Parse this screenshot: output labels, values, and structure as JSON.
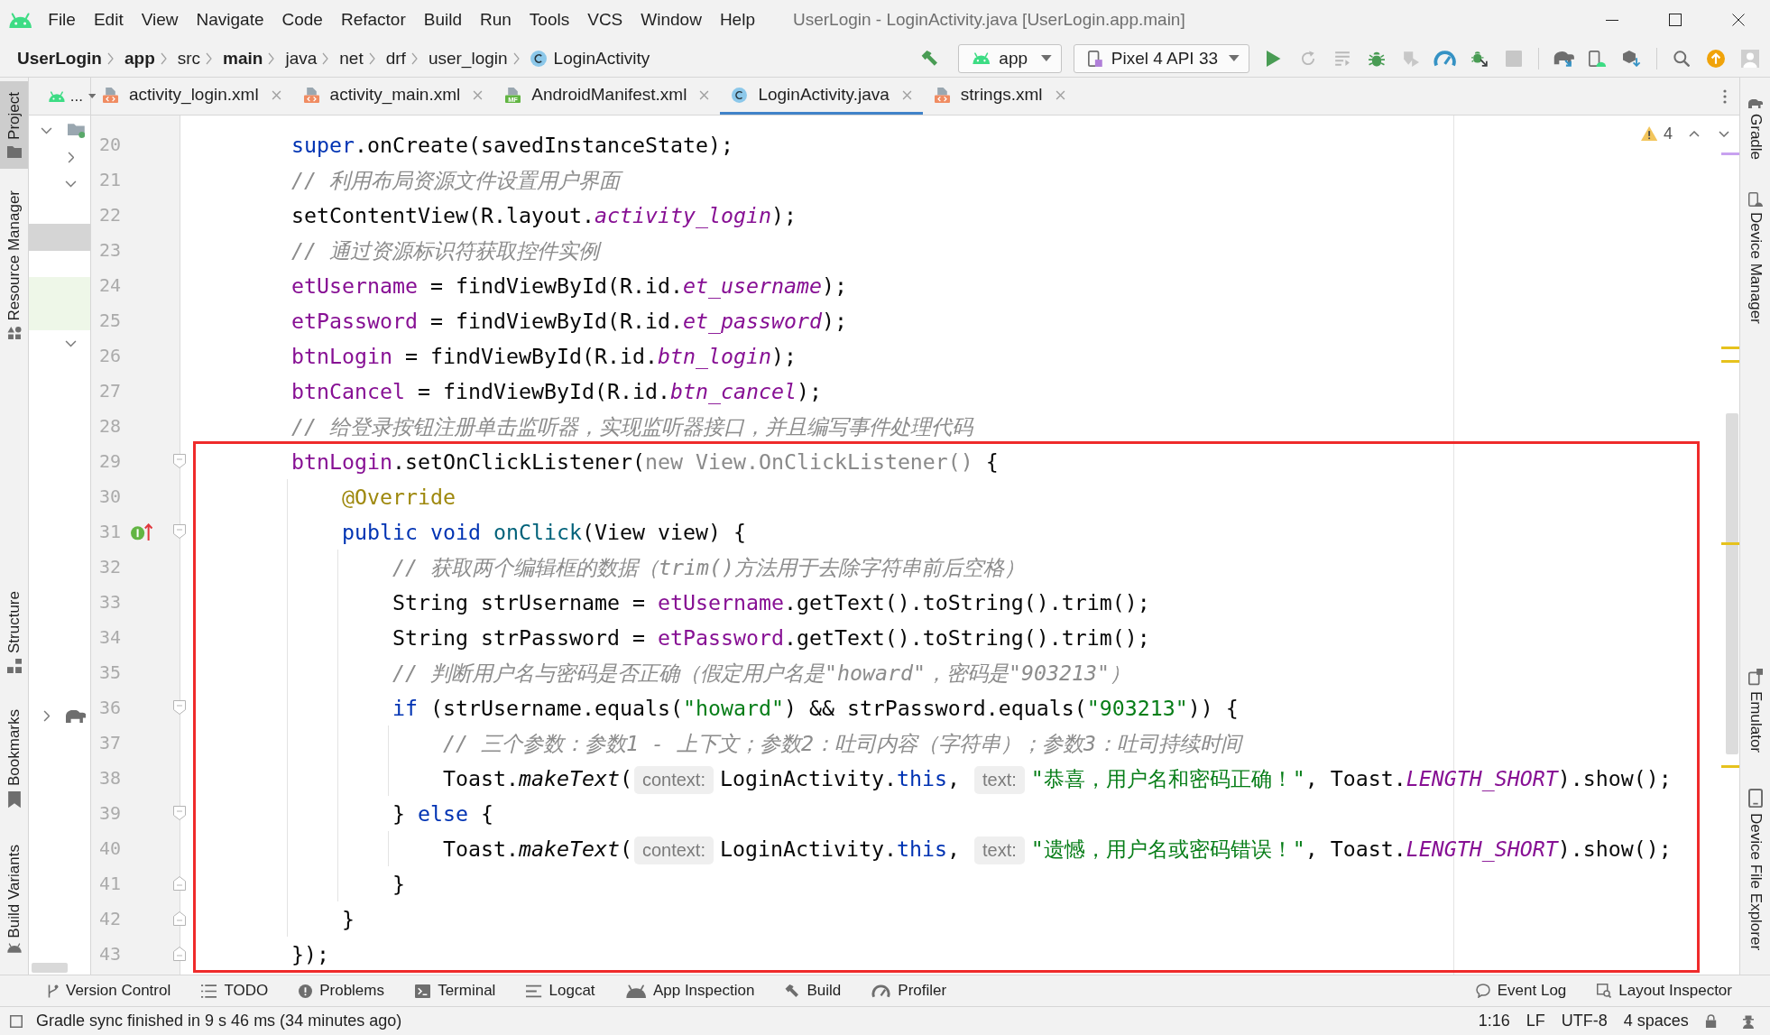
{
  "menu_bar": {
    "items": [
      "File",
      "Edit",
      "View",
      "Navigate",
      "Code",
      "Refactor",
      "Build",
      "Run",
      "Tools",
      "VCS",
      "Window",
      "Help"
    ],
    "title": "UserLogin - LoginActivity.java [UserLogin.app.main]"
  },
  "navigation_bar": {
    "breadcrumbs": [
      {
        "label": "UserLogin",
        "bold": true
      },
      {
        "label": "app",
        "bold": true
      },
      {
        "label": "src",
        "bold": false
      },
      {
        "label": "main",
        "bold": true
      },
      {
        "label": "java",
        "bold": false
      },
      {
        "label": "net",
        "bold": false
      },
      {
        "label": "drf",
        "bold": false
      },
      {
        "label": "user_login",
        "bold": false
      },
      {
        "label": "LoginActivity",
        "bold": false,
        "kind": "class"
      }
    ],
    "run_configuration": "app",
    "device": "Pixel 4 API 33",
    "actions": [
      {
        "kind": "run",
        "disabled": false
      },
      {
        "kind": "rerun",
        "disabled": true
      },
      {
        "kind": "apply-changes",
        "disabled": true
      },
      {
        "kind": "debug",
        "disabled": false
      },
      {
        "kind": "attach",
        "disabled": true
      },
      {
        "kind": "profile",
        "disabled": false
      },
      {
        "kind": "attach-debugger",
        "disabled": false
      },
      {
        "kind": "stop",
        "disabled": true
      }
    ]
  },
  "left_tool_strip": {
    "top": [
      {
        "label": "Project",
        "kind": "project",
        "selected": true
      },
      {
        "label": "Resource Manager",
        "kind": "resources",
        "selected": false
      }
    ],
    "bottom": [
      {
        "label": "Structure",
        "kind": "structure",
        "selected": false
      },
      {
        "label": "Bookmarks",
        "kind": "bookmarks",
        "selected": false
      },
      {
        "label": "Build Variants",
        "kind": "variants",
        "selected": false
      }
    ]
  },
  "right_tool_strip": {
    "top": [
      {
        "label": "Gradle",
        "kind": "gradle",
        "selected": false
      },
      {
        "label": "Device Manager",
        "kind": "device-manager",
        "selected": false
      }
    ],
    "bottom": [
      {
        "label": "Emulator",
        "kind": "emulator",
        "selected": false
      },
      {
        "label": "Device File Explorer",
        "kind": "file-explorer",
        "selected": false
      }
    ]
  },
  "project_panel": {
    "view_label": "...",
    "tree": [
      {
        "kind": "folder",
        "expanded": true,
        "selected": false,
        "children": [
          {
            "expanded": false,
            "selected": false
          },
          {
            "expanded": true,
            "selected": false,
            "children": [
              {
                "selected": false
              },
              {
                "selected": true
              },
              {
                "selected": false
              },
              {
                "kind": "test",
                "selected": false
              },
              {
                "kind": "test",
                "selected": false
              }
            ]
          },
          {
            "expanded": true,
            "selected": false,
            "children": [
              {
                "selected": false
              },
              {
                "selected": false
              },
              {
                "selected": false
              },
              {
                "selected": false
              },
              {
                "selected": false
              },
              {
                "selected": false
              },
              {
                "selected": false
              },
              {
                "selected": false
              },
              {
                "selected": false
              },
              {
                "selected": false
              },
              {
                "selected": false
              },
              {
                "selected": false
              },
              {
                "selected": false
              }
            ]
          }
        ]
      },
      {
        "kind": "gradle",
        "expanded": false,
        "selected": false
      }
    ]
  },
  "editor_tabs": [
    {
      "label": "activity_login.xml",
      "kind": "xml",
      "selected": false
    },
    {
      "label": "activity_main.xml",
      "kind": "xml",
      "selected": false
    },
    {
      "label": "AndroidManifest.xml",
      "kind": "manifest",
      "badge": "MF",
      "selected": false
    },
    {
      "label": "LoginActivity.java",
      "kind": "class",
      "selected": true
    },
    {
      "label": "strings.xml",
      "kind": "xml",
      "selected": false
    }
  ],
  "editor": {
    "warning_count": "4",
    "lines": [
      {
        "number": "20",
        "tokens": [
          {
            "kind": "keyword",
            "text": "        super"
          },
          {
            "kind": "plain",
            "text": ".onCreate(savedInstanceState);"
          }
        ]
      },
      {
        "number": "21",
        "tokens": [
          {
            "kind": "comment",
            "text": "        // 利用布局资源文件设置用户界面"
          }
        ]
      },
      {
        "number": "22",
        "tokens": [
          {
            "kind": "plain",
            "text": "        setContentView(R.layout."
          },
          {
            "kind": "static",
            "text": "activity_login"
          },
          {
            "kind": "plain",
            "text": ");"
          }
        ]
      },
      {
        "number": "23",
        "tokens": [
          {
            "kind": "comment",
            "text": "        // 通过资源标识符获取控件实例"
          }
        ]
      },
      {
        "number": "24",
        "tokens": [
          {
            "kind": "field",
            "text": "        etUsername"
          },
          {
            "kind": "plain",
            "text": " = findViewById(R.id."
          },
          {
            "kind": "static",
            "text": "et_username"
          },
          {
            "kind": "plain",
            "text": ");"
          }
        ]
      },
      {
        "number": "25",
        "tokens": [
          {
            "kind": "field",
            "text": "        etPassword"
          },
          {
            "kind": "plain",
            "text": " = findViewById(R.id."
          },
          {
            "kind": "static",
            "text": "et_password"
          },
          {
            "kind": "plain",
            "text": ");"
          }
        ]
      },
      {
        "number": "26",
        "tokens": [
          {
            "kind": "field",
            "text": "        btnLogin"
          },
          {
            "kind": "plain",
            "text": " = findViewById(R.id."
          },
          {
            "kind": "static",
            "text": "btn_login"
          },
          {
            "kind": "plain",
            "text": ");"
          }
        ]
      },
      {
        "number": "27",
        "tokens": [
          {
            "kind": "field",
            "text": "        btnCancel"
          },
          {
            "kind": "plain",
            "text": " = findViewById(R.id."
          },
          {
            "kind": "static",
            "text": "btn_cancel"
          },
          {
            "kind": "plain",
            "text": ");"
          }
        ]
      },
      {
        "number": "28",
        "tokens": [
          {
            "kind": "comment",
            "text": "        // 给登录按钮注册单击监听器，实现监听器接口，并且编写事件处理代码"
          }
        ]
      }
    ],
    "boxed_lines": [
      {
        "number": "29",
        "gutter_icons": [
          {
            "kind": "fold-start"
          }
        ],
        "tokens": [
          {
            "kind": "field",
            "text": "        btnLogin"
          },
          {
            "kind": "plain",
            "text": ".setOnClickListener("
          },
          {
            "kind": "dim",
            "text": "new View.OnClickListener()"
          },
          {
            "kind": "plain",
            "text": " {"
          }
        ]
      },
      {
        "number": "30",
        "tokens": [
          {
            "kind": "annotation",
            "text": "            @Override"
          }
        ]
      },
      {
        "number": "31",
        "gutter_icons": [
          {
            "kind": "override"
          },
          {
            "kind": "fold-start"
          }
        ],
        "tokens": [
          {
            "kind": "keyword",
            "text": "            public void "
          },
          {
            "kind": "declaration",
            "text": "onClick"
          },
          {
            "kind": "plain",
            "text": "(View view) {"
          }
        ]
      },
      {
        "number": "32",
        "tokens": [
          {
            "kind": "comment",
            "text": "                // 获取两个编辑框的数据（trim()方法用于去除字符串前后空格）"
          }
        ]
      },
      {
        "number": "33",
        "tokens": [
          {
            "kind": "plain",
            "text": "                String strUsername = "
          },
          {
            "kind": "field",
            "text": "etUsername"
          },
          {
            "kind": "plain",
            "text": ".getText().toString().trim();"
          }
        ]
      },
      {
        "number": "34",
        "tokens": [
          {
            "kind": "plain",
            "text": "                String strPassword = "
          },
          {
            "kind": "field",
            "text": "etPassword"
          },
          {
            "kind": "plain",
            "text": ".getText().toString().trim();"
          }
        ]
      },
      {
        "number": "35",
        "tokens": [
          {
            "kind": "comment",
            "text": "                // 判断用户名与密码是否正确（假定用户名是\"howard\"，密码是\"903213\"）"
          }
        ]
      },
      {
        "number": "36",
        "gutter_icons": [
          {
            "kind": "fold-start"
          }
        ],
        "tokens": [
          {
            "kind": "keyword",
            "text": "                if"
          },
          {
            "kind": "plain",
            "text": " (strUsername.equals("
          },
          {
            "kind": "string",
            "text": "\"howard\""
          },
          {
            "kind": "plain",
            "text": ") && strPassword.equals("
          },
          {
            "kind": "string",
            "text": "\"903213\""
          },
          {
            "kind": "plain",
            "text": ")) {"
          }
        ]
      },
      {
        "number": "37",
        "tokens": [
          {
            "kind": "comment",
            "text": "                    // 三个参数：参数1 - 上下文；参数2：吐司内容（字符串）；参数3：吐司持续时间"
          }
        ]
      },
      {
        "number": "38",
        "tokens": [
          {
            "kind": "plain",
            "text": "                    Toast."
          },
          {
            "kind": "call",
            "text": "makeText"
          },
          {
            "kind": "plain",
            "text": "("
          },
          {
            "kind": "hint",
            "text": "context:"
          },
          {
            "kind": "plain",
            "text": "LoginActivity."
          },
          {
            "kind": "keyword",
            "text": "this"
          },
          {
            "kind": "plain",
            "text": ", "
          },
          {
            "kind": "hint",
            "text": "text:"
          },
          {
            "kind": "string",
            "text": "\"恭喜，用户名和密码正确！\""
          },
          {
            "kind": "plain",
            "text": ", Toast."
          },
          {
            "kind": "static",
            "text": "LENGTH_SHORT"
          },
          {
            "kind": "plain",
            "text": ").show();"
          }
        ]
      },
      {
        "number": "39",
        "gutter_icons": [
          {
            "kind": "fold-start"
          }
        ],
        "tokens": [
          {
            "kind": "plain",
            "text": "                } "
          },
          {
            "kind": "keyword",
            "text": "else"
          },
          {
            "kind": "plain",
            "text": " {"
          }
        ]
      },
      {
        "number": "40",
        "tokens": [
          {
            "kind": "plain",
            "text": "                    Toast."
          },
          {
            "kind": "call",
            "text": "makeText"
          },
          {
            "kind": "plain",
            "text": "("
          },
          {
            "kind": "hint",
            "text": "context:"
          },
          {
            "kind": "plain",
            "text": "LoginActivity."
          },
          {
            "kind": "keyword",
            "text": "this"
          },
          {
            "kind": "plain",
            "text": ", "
          },
          {
            "kind": "hint",
            "text": "text:"
          },
          {
            "kind": "string",
            "text": "\"遗憾，用户名或密码错误！\""
          },
          {
            "kind": "plain",
            "text": ", Toast."
          },
          {
            "kind": "static",
            "text": "LENGTH_SHORT"
          },
          {
            "kind": "plain",
            "text": ").show();"
          }
        ]
      },
      {
        "number": "41",
        "gutter_icons": [
          {
            "kind": "fold-end"
          }
        ],
        "tokens": [
          {
            "kind": "plain",
            "text": "                }"
          }
        ]
      },
      {
        "number": "42",
        "gutter_icons": [
          {
            "kind": "fold-end"
          }
        ],
        "tokens": [
          {
            "kind": "plain",
            "text": "            }"
          }
        ]
      },
      {
        "number": "43",
        "gutter_icons": [
          {
            "kind": "fold-end"
          }
        ],
        "tokens": [
          {
            "kind": "plain",
            "text": "        });"
          }
        ]
      }
    ]
  },
  "tool_window_bar": {
    "left": [
      {
        "label": "Version Control",
        "kind": "vcs",
        "selected": false
      },
      {
        "label": "TODO",
        "kind": "todo",
        "selected": false
      },
      {
        "label": "Problems",
        "kind": "problems",
        "selected": false
      },
      {
        "label": "Terminal",
        "kind": "terminal",
        "selected": false
      },
      {
        "label": "Logcat",
        "kind": "logcat",
        "selected": false
      },
      {
        "label": "App Inspection",
        "kind": "inspection",
        "selected": false
      },
      {
        "label": "Build",
        "kind": "build",
        "selected": false
      },
      {
        "label": "Profiler",
        "kind": "profiler",
        "selected": false
      }
    ],
    "right": [
      {
        "label": "Event Log",
        "kind": "event-log",
        "selected": false
      },
      {
        "label": "Layout Inspector",
        "kind": "layout-inspector",
        "selected": false
      }
    ]
  },
  "status_bar": {
    "message": "Gradle sync finished in 9 s 46 ms (34 minutes ago)",
    "items": [
      "1:16",
      "LF",
      "UTF-8",
      "4 spaces"
    ]
  }
}
